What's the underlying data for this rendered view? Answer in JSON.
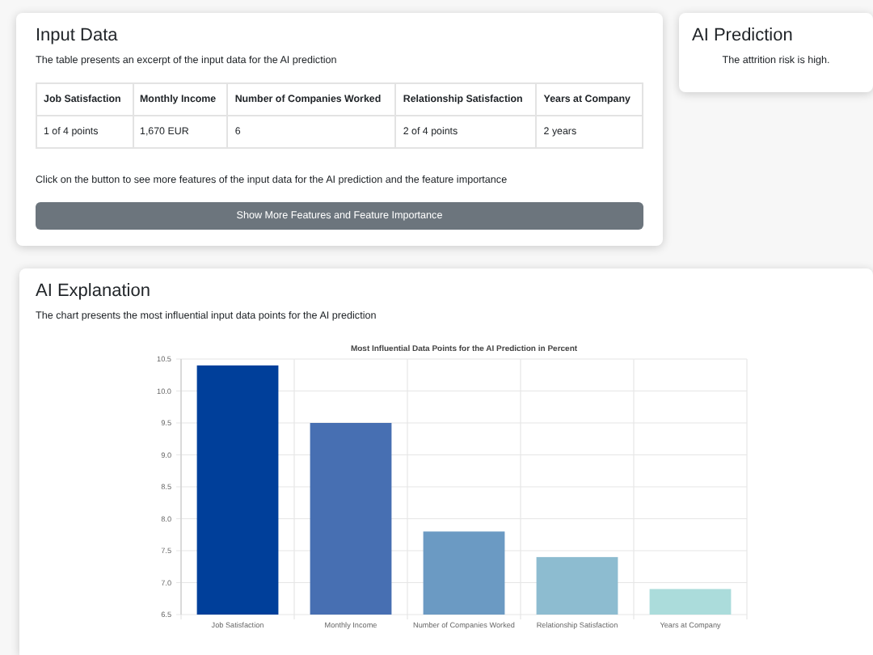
{
  "input_data": {
    "title": "Input Data",
    "description": "The table presents an excerpt of the input data for the AI prediction",
    "table": {
      "columns": [
        "Job Satisfaction",
        "Monthly Income",
        "Number of Companies Worked",
        "Relationship Satisfaction",
        "Years at Company"
      ],
      "rows": [
        [
          "1 of 4 points",
          "1,670 EUR",
          "6",
          "2 of 4 points",
          "2 years"
        ]
      ]
    },
    "hint": "Click on the button to see more features of the input data for the AI prediction and the feature importance",
    "button": "Show More Features and Feature Importance"
  },
  "prediction": {
    "title": "AI Prediction",
    "text": "The attrition risk is high."
  },
  "explanation": {
    "title": "AI Explanation",
    "description": "The chart presents the most influential input data points for the AI prediction",
    "chart_data": {
      "type": "bar",
      "title": "Most Influential Data Points for the AI Prediction in Percent",
      "categories": [
        "Job Satisfaction",
        "Monthly Income",
        "Number of Companies Worked",
        "Relationship Satisfaction",
        "Years at Company"
      ],
      "grid": true,
      "series": [
        {
          "colors": [
            "#003f9a",
            "#476fb2",
            "#6b9ac3",
            "#8dbcd0",
            "#abdcdb"
          ],
          "values": [
            10.4,
            9.5,
            7.8,
            7.4,
            6.9
          ]
        }
      ],
      "ylim": [
        6.5,
        10.5
      ],
      "yticks": [
        {
          "value": 6.5,
          "label": "6.5"
        },
        {
          "value": 7,
          "label": "7.0"
        },
        {
          "value": 7.5,
          "label": "7.5"
        },
        {
          "value": 8,
          "label": "8.0"
        },
        {
          "value": 8.5,
          "label": "8.5"
        },
        {
          "value": 9,
          "label": "9.0"
        },
        {
          "value": 9.5,
          "label": "9.5"
        },
        {
          "value": 10,
          "label": "10.0"
        },
        {
          "value": 10.5,
          "label": "10.5"
        }
      ]
    }
  }
}
